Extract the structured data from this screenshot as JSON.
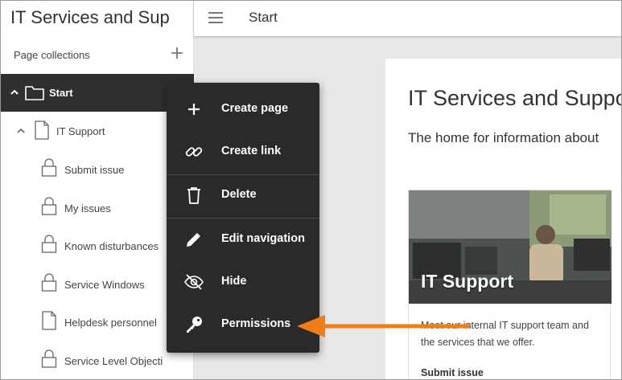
{
  "app": {
    "title": "IT Services and Sup"
  },
  "sidebar": {
    "collections_label": "Page collections",
    "root": {
      "label": "Start",
      "expanded": true
    },
    "items": [
      {
        "label": "IT Support",
        "icon": "page-icon",
        "expanded": true
      },
      {
        "label": "Submit issue",
        "icon": "lock-icon"
      },
      {
        "label": "My issues",
        "icon": "lock-icon"
      },
      {
        "label": "Known disturbances",
        "icon": "lock-icon"
      },
      {
        "label": "Service Windows",
        "icon": "lock-icon"
      },
      {
        "label": "Helpdesk personnel",
        "icon": "page-icon"
      },
      {
        "label": "Service Level Objecti",
        "icon": "lock-icon"
      }
    ]
  },
  "topbar": {
    "title": "Start"
  },
  "main": {
    "heading": "IT Services and Suppo",
    "subheading": "The home for information about",
    "tile": {
      "title": "IT Support",
      "text": "Meet our internal IT support team and the services that we offer.",
      "link": "Submit issue"
    }
  },
  "context_menu": {
    "items": [
      {
        "label": "Create page",
        "icon": "plus-icon"
      },
      {
        "label": "Create link",
        "icon": "link-icon"
      },
      {
        "label": "Delete",
        "icon": "trash-icon"
      },
      {
        "label": "Edit navigation",
        "icon": "pencil-icon"
      },
      {
        "label": "Hide",
        "icon": "eye-off-icon"
      },
      {
        "label": "Permissions",
        "icon": "key-icon"
      }
    ]
  },
  "colors": {
    "selected_row": "#2f2f2f",
    "menu_bg": "#2a2a2a",
    "arrow": "#f07d1a",
    "main_bg": "#e8e8e8"
  }
}
